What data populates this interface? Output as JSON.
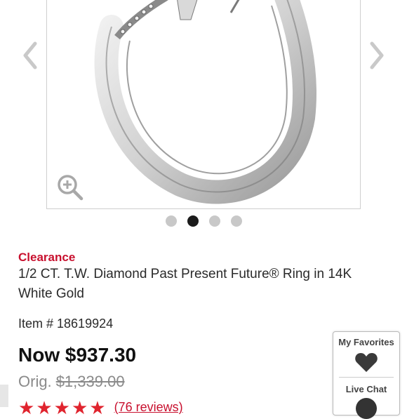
{
  "product": {
    "tag": "Clearance",
    "title": "1/2 CT. T.W. Diamond Past Present Future® Ring in 14K White Gold",
    "item_number": "Item # 18619924",
    "price_now": "Now $937.30",
    "orig_label": "Orig.",
    "orig_price": "$1,339.00",
    "rating_stars": 5,
    "reviews_text": "(76 reviews)"
  },
  "gallery": {
    "dots": [
      "image-1",
      "image-2",
      "image-3",
      "image-4"
    ],
    "active_index": 1
  },
  "side_panel": {
    "favorites_label": "My Favorites",
    "chat_label": "Live Chat"
  },
  "icons": {
    "prev": "chevron-left-icon",
    "next": "chevron-right-icon",
    "zoom": "zoom-in-icon",
    "favorite": "heart-icon",
    "chat": "chat-icon",
    "rating": "star-icon"
  },
  "colors": {
    "accent": "#c8102e",
    "star": "#e0242e",
    "dot_active": "#1b1b1b",
    "dot_inactive": "#c8c8c8"
  }
}
